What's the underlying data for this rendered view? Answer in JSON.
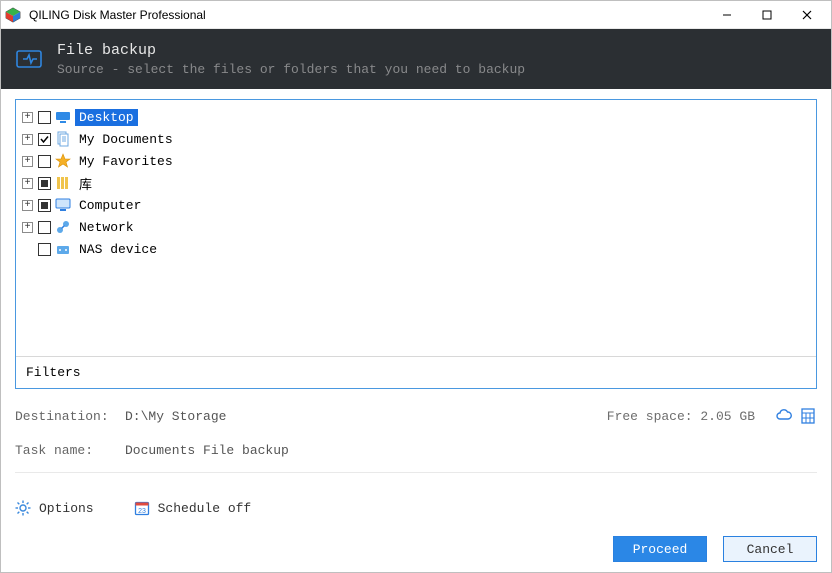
{
  "titlebar": {
    "title": "QILING Disk Master Professional"
  },
  "header": {
    "title": "File backup",
    "subtitle": "Source - select the files or folders that you need to backup"
  },
  "tree": {
    "items": [
      {
        "label": "Desktop",
        "expandable": true,
        "check": "unchecked",
        "icon": "desktop",
        "selected": true
      },
      {
        "label": "My Documents",
        "expandable": true,
        "check": "checked",
        "icon": "documents",
        "selected": false
      },
      {
        "label": "My Favorites",
        "expandable": true,
        "check": "unchecked",
        "icon": "star",
        "selected": false
      },
      {
        "label": "库",
        "expandable": true,
        "check": "partial",
        "icon": "library",
        "selected": false
      },
      {
        "label": "Computer",
        "expandable": true,
        "check": "partial",
        "icon": "computer",
        "selected": false
      },
      {
        "label": "Network",
        "expandable": true,
        "check": "unchecked",
        "icon": "network",
        "selected": false
      },
      {
        "label": "NAS device",
        "expandable": false,
        "check": "unchecked",
        "icon": "nas",
        "selected": false
      }
    ],
    "filters_label": "Filters"
  },
  "destination": {
    "label": "Destination:",
    "value": "D:\\My Storage",
    "free_space_label": "Free space: 2.05 GB"
  },
  "task": {
    "label": "Task name:",
    "value": "Documents File backup"
  },
  "options": {
    "options_label": "Options",
    "schedule_label": "Schedule off"
  },
  "footer": {
    "proceed": "Proceed",
    "cancel": "Cancel"
  }
}
